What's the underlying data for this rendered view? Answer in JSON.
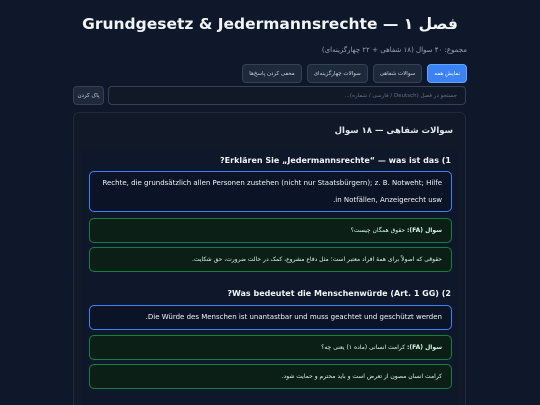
{
  "header": {
    "title": "Grundgesetz & Jedermannsrechte — فصل ۱",
    "subtitle": "مجموع: ۴۰ سوال (۱۸ شفاهی + ۲۲ چهارگزینه‌ای)"
  },
  "tabs": [
    {
      "label": "نمایش همه",
      "active": true
    },
    {
      "label": "سوالات شفاهی",
      "active": false
    },
    {
      "label": "سوالات چهارگزینه‌ای",
      "active": false
    },
    {
      "label": "مخفی کردن پاسخ‌ها",
      "active": false
    }
  ],
  "search": {
    "placeholder": "جستجو در فصل (Deutsch / فارسی / شماره)...",
    "clear_label": "پاک کردن"
  },
  "section": {
    "title": "سوالات شفاهی — ۱۸ سوال"
  },
  "questions": [
    {
      "title": "1) Erklären Sie „Jedermannsrechte“ — was ist das?",
      "answer_de": "Rechte, die grundsätzlich allen Personen zustehen (nicht nur Staatsbürgern); z. B. Notweht; Hilfe in Notfällen, Anzeigerecht usw.",
      "question_fa_label": "سوال (FA):",
      "question_fa": "حقوق همگان چیست؟",
      "answer_fa": "حقوقی که اصولاً برای همهٔ افراد معتبر است؛ مثل دفاع مشروع، کمک در حالت ضرورت، حق شکایت."
    },
    {
      "title": "2) Was bedeutet die Menschenwürde (Art. 1 GG)?",
      "answer_de": "Die Würde des Menschen ist unantastbar und muss geachtet und geschützt werden.",
      "question_fa_label": "سوال (FA):",
      "question_fa": "کرامت انسانی (ماده ۱) یعنی چه؟",
      "answer_fa": "کرامت انسان مصون از تعرض است و باید محترم و حمایت شود."
    }
  ]
}
